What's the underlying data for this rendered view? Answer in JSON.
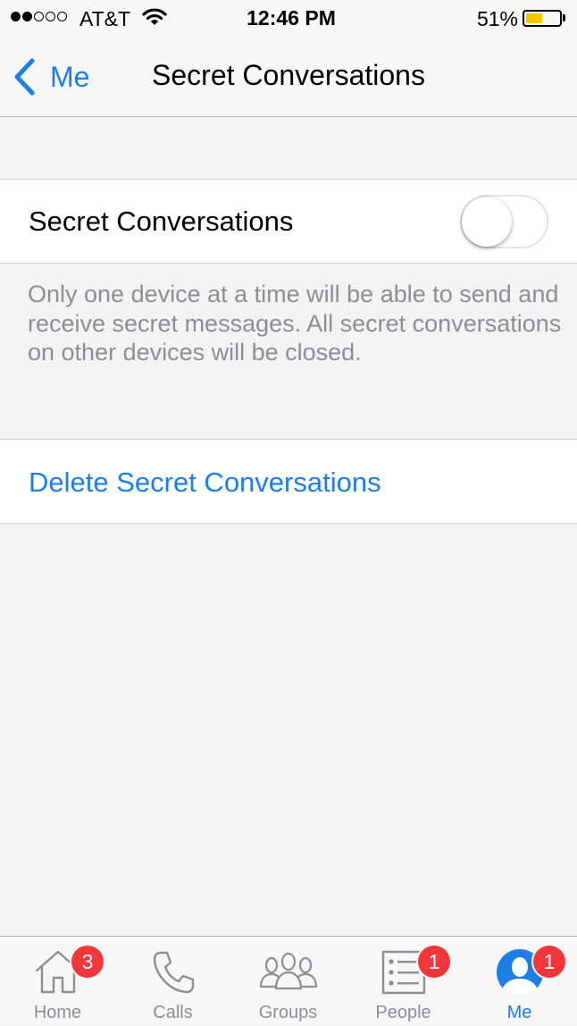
{
  "status_bar": {
    "carrier": "AT&T",
    "time": "12:46 PM",
    "battery_percent": "51%",
    "battery_level": 0.51,
    "signal_strength": 2,
    "signal_total": 5
  },
  "nav": {
    "back_label": "Me",
    "title": "Secret Conversations"
  },
  "settings": {
    "toggle_label": "Secret Conversations",
    "toggle_on": false,
    "footer_note": "Only one device at a time will be able to send and receive secret messages. All secret conversations on other devices will be closed.",
    "delete_label": "Delete Secret Conversations"
  },
  "tab_bar": {
    "tabs": [
      {
        "label": "Home",
        "icon": "home-icon",
        "badge": "3",
        "active": false
      },
      {
        "label": "Calls",
        "icon": "phone-icon",
        "badge": "",
        "active": false
      },
      {
        "label": "Groups",
        "icon": "groups-icon",
        "badge": "",
        "active": false
      },
      {
        "label": "People",
        "icon": "people-list-icon",
        "badge": "1",
        "active": false
      },
      {
        "label": "Me",
        "icon": "profile-icon",
        "badge": "1",
        "active": true
      }
    ]
  },
  "colors": {
    "accent": "#1e7ee4",
    "badge": "#f2373c",
    "battery": "#f7c600",
    "inactive": "#8e8e93"
  }
}
